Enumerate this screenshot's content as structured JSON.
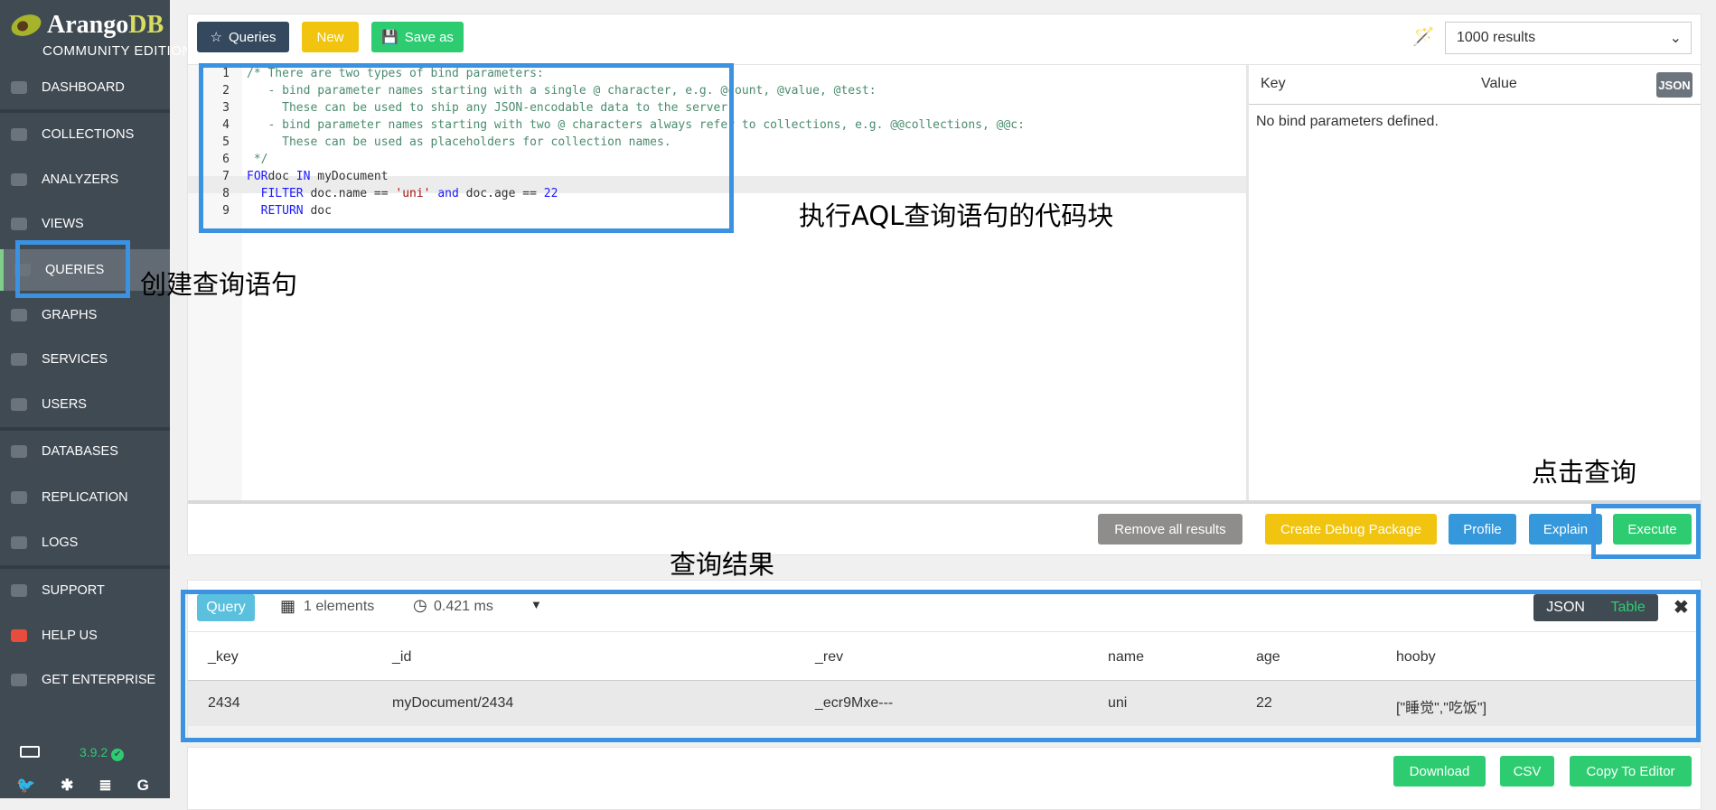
{
  "sidebar": {
    "brand": "Arango",
    "brand_accent": "DB",
    "edition": "COMMUNITY EDITION",
    "items": [
      {
        "label": "DASHBOARD",
        "icon": "dashboard-icon"
      },
      {
        "label": "COLLECTIONS",
        "icon": "folder-icon"
      },
      {
        "label": "ANALYZERS",
        "icon": "gear-icon"
      },
      {
        "label": "VIEWS",
        "icon": "eye-icon"
      },
      {
        "label": "QUERIES",
        "icon": "terminal-icon",
        "active": true
      },
      {
        "label": "GRAPHS",
        "icon": "sitemap-icon"
      },
      {
        "label": "SERVICES",
        "icon": "cogs-icon"
      },
      {
        "label": "USERS",
        "icon": "users-icon"
      },
      {
        "label": "DATABASES",
        "icon": "database-icon"
      },
      {
        "label": "REPLICATION",
        "icon": "server-icon"
      },
      {
        "label": "LOGS",
        "icon": "file-icon"
      },
      {
        "label": "SUPPORT",
        "icon": "lifebuoy-icon"
      },
      {
        "label": "HELP US",
        "icon": "heart-icon"
      },
      {
        "label": "GET ENTERPRISE",
        "icon": "external-link-icon"
      }
    ],
    "version": "3.9.2",
    "social": [
      "twitter-icon",
      "slack-icon",
      "stackoverflow-icon",
      "google-icon"
    ]
  },
  "toolbar": {
    "queries": "Queries",
    "new": "New",
    "save_as": "Save as",
    "limit": "1000 results"
  },
  "editor": {
    "lines": [
      [
        [
          "cm",
          "/* There are two types of bind parameters:"
        ]
      ],
      [
        [
          "cm",
          "   - bind parameter names starting with a single @ character, e.g. @count, @value, @test:"
        ]
      ],
      [
        [
          "cm",
          "     These can be used to ship any JSON-encodable data to the server."
        ]
      ],
      [
        [
          "cm",
          "   - bind parameter names starting with two @ characters always refer to collections, e.g. @@collections, @@c:"
        ]
      ],
      [
        [
          "cm",
          "     These can be used as placeholders for collection names."
        ]
      ],
      [
        [
          "cm",
          " */"
        ]
      ],
      [
        [
          "kw",
          "FOR"
        ],
        [
          "",
          "doc "
        ],
        [
          "kw",
          "IN"
        ],
        [
          "",
          " myDocument"
        ]
      ],
      [
        [
          "",
          "  "
        ],
        [
          "kw",
          "FILTER"
        ],
        [
          "",
          " doc.name == "
        ],
        [
          "st",
          "'uni'"
        ],
        [
          "",
          " "
        ],
        [
          "kw",
          "and"
        ],
        [
          "",
          " doc.age == "
        ],
        [
          "nm",
          "22"
        ]
      ],
      [
        [
          "",
          "  "
        ],
        [
          "kw",
          "RETURN"
        ],
        [
          "",
          " doc"
        ]
      ]
    ]
  },
  "bind": {
    "key": "Key",
    "value": "Value",
    "json": "JSON",
    "empty": "No bind parameters defined."
  },
  "actions": {
    "remove": "Remove all results",
    "debug": "Create Debug Package",
    "profile": "Profile",
    "explain": "Explain",
    "execute": "Execute"
  },
  "result": {
    "badge": "Query",
    "count": "1 elements",
    "time": "0.421 ms",
    "json": "JSON",
    "table": "Table",
    "columns": [
      "_key",
      "_id",
      "_rev",
      "name",
      "age",
      "hooby"
    ],
    "rows": [
      [
        "2434",
        "myDocument/2434",
        "_ecr9Mxe---",
        "uni",
        "22",
        "[\"睡觉\",\"吃饭\"]"
      ]
    ],
    "download": "Download",
    "csv": "CSV",
    "copy": "Copy To Editor"
  },
  "annotations": {
    "editor": "执行AQL查询语句的代码块",
    "queries": "创建查询语句",
    "execute": "点击查询",
    "results": "查询结果"
  },
  "colors": {
    "sidebar": "#404a53",
    "green": "#2ecc71",
    "yellow": "#f1c40f",
    "blue": "#3498db",
    "gray": "#8f8d8c",
    "dark": "#34495e",
    "annotation": "#3a92e0"
  }
}
